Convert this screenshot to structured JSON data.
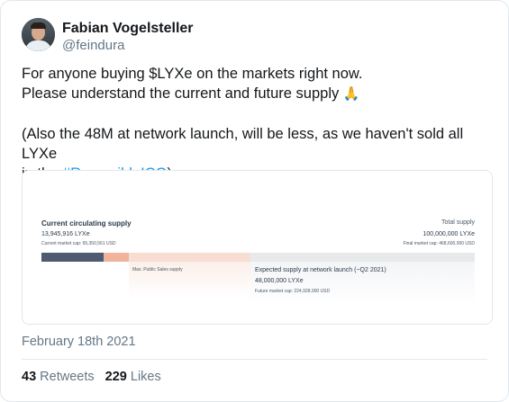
{
  "author": {
    "name": "Fabian Vogelsteller",
    "handle": "@feindura"
  },
  "tweet": {
    "line1": "For anyone buying $LYXe on the markets right now.",
    "line2": "Please understand the current and future supply",
    "emoji": "🙏",
    "line3": "(Also the 48M at network launch, will be less, as we haven't sold all LYXe",
    "line4_prefix": "in the",
    "hashtag": "#ReversibleICO",
    "line4_suffix": ")"
  },
  "infographic": {
    "current_title": "Current circulating supply",
    "current_amount": "13,945,916 LYXe",
    "current_cap": "Current market cap: 65,350,561 USD",
    "total_title": "Total supply",
    "total_amount": "100,000,000 LYXe",
    "total_cap": "Final market cap: 468,600,000 USD",
    "public_sales_label": "Max. Public Sales supply",
    "expected_title": "Expected supply at network launch (~Q2 2021)",
    "expected_amount": "48,000,000 LYXe",
    "expected_cap": "Future market cap: 224,928,000 USD",
    "colors": {
      "circulating": "#4d5a70",
      "public_sales": "#f1b39a",
      "expected": "#f7ddd2",
      "remaining": "#e8e9eb"
    }
  },
  "date": "February 18th 2021",
  "stats": {
    "retweets_count": "43",
    "retweets_label": "Retweets",
    "likes_count": "229",
    "likes_label": "Likes"
  }
}
